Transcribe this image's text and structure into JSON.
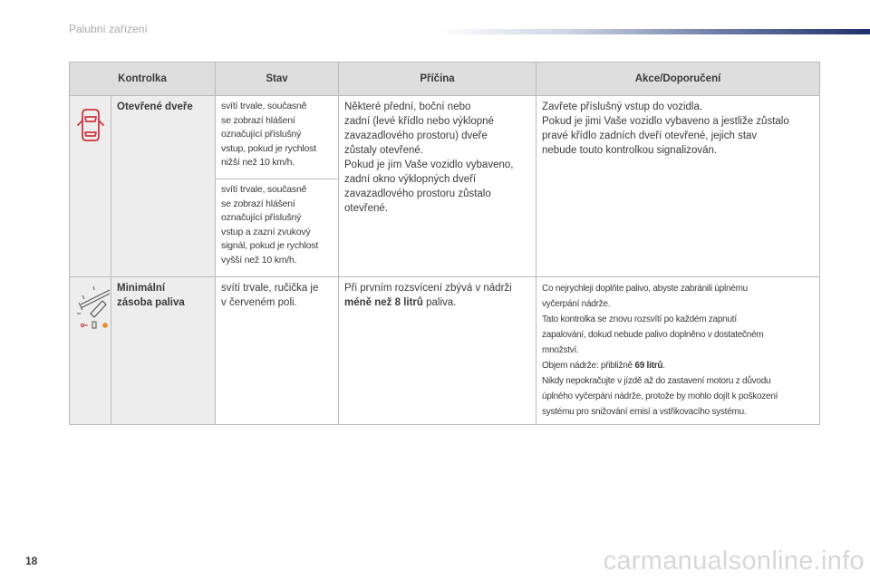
{
  "page": {
    "section_title": "Palubní zařízení",
    "page_number": "18",
    "watermark": "carmanualsonline.info"
  },
  "colors": {
    "warning_red": "#d0343f",
    "header_gray": "#dedede",
    "cell_gray": "#ededed",
    "brand_navy": "#1e2f6b"
  },
  "table": {
    "headers": [
      "Kontrolka",
      "Stav",
      "Příčina",
      "Akce/Doporučení"
    ],
    "rows": [
      {
        "icon": "open-door-warning-icon",
        "name": "Otevřené dveře",
        "status_1": "svítí trvale, současně\nse zobrazí hlášení\noznačující příslušný\nvstup, pokud je rychlost\nnižší než 10 km/h.",
        "status_2": "svítí trvale, současně\nse zobrazí hlášení\noznačující příslušný\nvstup a zazní zvukový\nsignál, pokud je rychlost\nvyšší než 10 km/h.",
        "cause": "Některé přední, boční nebo\nzadní (levé křídlo nebo výklopné\nzavazadlového prostoru) dveře\nzůstaly otevřené.\nPokud je jím Vaše vozidlo vybaveno,\nzadní okno výklopných dveří\nzavazadlového prostoru zůstalo\notevřené.",
        "action": "Zavřete příslušný vstup do vozidla.\nPokud je jimi Vaše vozidlo vybaveno a jestliže zůstalo\npravé křídlo zadních dveří otevřené, jejich stav\nnebude touto kontrolkou signalizován."
      },
      {
        "icon": "fuel-gauge-icon",
        "name": "Minimální\nzásoba paliva",
        "status": "svítí trvale, ručička je\nv červeném poli.",
        "cause_pre": "Při prvním rozsvícení zbývá v nádrži",
        "cause_bold": "méně než 8 litrů",
        "cause_post": " paliva.",
        "action_1": "Co nejrychleji doplňte palivo, abyste zabránili úplnému\nvyčerpání nádrže.\nTato kontrolka se znovu rozsvítí po každém zapnutí\nzapalování, dokud nebude palivo doplněno v dostatečném\nmnožství.\nObjem nádrže: přibližně ",
        "action_bold": "69 litrů",
        "action_2": ".\nNikdy nepokračujte v jízdě až do zastavení motoru z důvodu\núplného vyčerpání nádrže, protože by mohlo dojít k poškození\nsystému pro snižování emisí a vstřikovacího systému."
      }
    ]
  }
}
